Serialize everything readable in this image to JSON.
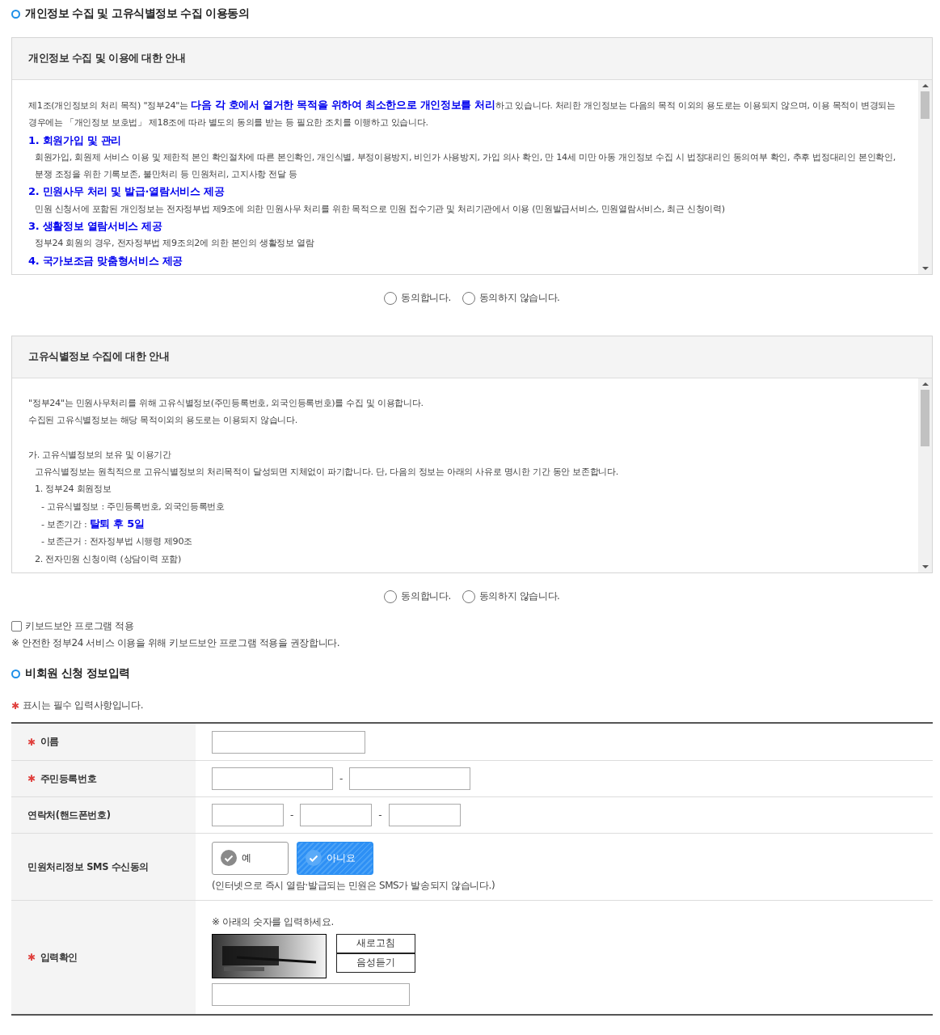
{
  "agreement_title": "개인정보 수집 및 고유식별정보 수집 이용동의",
  "notices": [
    {
      "title": "개인정보 수집 및 이용에 대한 안내",
      "lines": [
        {
          "kind": "text",
          "text": "제1조(개인정보의 처리 목적) \"정부24\"는 **다음 각 호에서 열거한 목적을 위하여 최소한으로 개인정보를 처리**하고 있습니다. 처리한 개인정보는 다음의 목적 이외의 용도로는 이용되지 않으며, 이용 목적이 변경되는 경우에는 「개인정보 보호법」 제18조에 따라 별도의 동의를 받는 등 필요한 조치를 이행하고 있습니다."
        },
        {
          "kind": "heading",
          "text": "1. 회원가입 및 관리"
        },
        {
          "kind": "indent",
          "text": "회원가입, 회원제 서비스 이용 및 제한적 본인 확인절차에 따른 본인확인, 개인식별, 부정이용방지, 비인가 사용방지, 가입 의사 확인, 만 14세 미만 아동 개인정보 수집 시 법정대리인 동의여부 확인, 추후 법정대리인 본인확인, 분쟁 조정을 위한 기록보존, 불만처리 등 민원처리, 고지사항 전달 등"
        },
        {
          "kind": "heading",
          "text": "2. 민원사무 처리 및 발급·열람서비스 제공"
        },
        {
          "kind": "indent",
          "text": "민원 신청서에 포함된 개인정보는 전자정부법 제9조에 의한 민원사무 처리를 위한 목적으로 민원 접수기관 및 처리기관에서 이용 (민원발급서비스, 민원열람서비스, 최근 신청이력)"
        },
        {
          "kind": "heading",
          "text": "3. 생활정보 열람서비스 제공"
        },
        {
          "kind": "indent",
          "text": "정부24 회원의 경우, 전자정부법 제9조의2에 의한 본인의 생활정보 열람"
        },
        {
          "kind": "heading",
          "text": "4. 국가보조금 맞춤형서비스 제공"
        }
      ],
      "options": [
        {
          "label": "동의합니다.",
          "selected": false
        },
        {
          "label": "동의하지 않습니다.",
          "selected": false
        }
      ]
    },
    {
      "title": "고유식별정보 수집에 대한 안내",
      "lines": [
        {
          "kind": "text",
          "text": "\"정부24\"는 민원사무처리를 위해 고유식별정보(주민등록번호, 외국인등록번호)를 수집 및 이용합니다."
        },
        {
          "kind": "text",
          "text": "수집된 고유식별정보는 해당 목적이외의 용도로는 이용되지 않습니다."
        },
        {
          "kind": "blank"
        },
        {
          "kind": "text",
          "text": "가. 고유식별정보의 보유 및 이용기간"
        },
        {
          "kind": "indent",
          "text": "고유식별정보는 원칙적으로 고유식별정보의 처리목적이 달성되면 지체없이 파기합니다. 단, 다음의 정보는 아래의 사유로 명시한 기간 동안 보존합니다."
        },
        {
          "kind": "indent",
          "text": "1. 정부24 회원정보"
        },
        {
          "kind": "sub",
          "text": "- 고유식별정보 : 주민등록번호, 외국인등록번호"
        },
        {
          "kind": "sub",
          "text": "- 보존기간 : **탈퇴 후 5일**"
        },
        {
          "kind": "sub",
          "text": "- 보존근거 : 전자정부법 시행령 제90조"
        },
        {
          "kind": "indent",
          "text": "2. 전자민원 신청이력 (상담이력 포함)"
        }
      ],
      "options": [
        {
          "label": "동의합니다.",
          "selected": false
        },
        {
          "label": "동의하지 않습니다.",
          "selected": false
        }
      ]
    }
  ],
  "keyboard_security": {
    "label": "키보드보안 프로그램 적용",
    "checked": false,
    "note": "※ 안전한 정부24 서비스 이용을 위해 키보드보안 프로그램 적용을 권장합니다."
  },
  "form_title": "비회원 신청 정보입력",
  "required_mark": "✱",
  "required_note": "표시는 필수 입력사항입니다.",
  "rows": [
    {
      "kind": "name",
      "label": "이름",
      "required": true
    },
    {
      "kind": "resident",
      "label": "주민등록번호",
      "required": true,
      "separator": "-"
    },
    {
      "kind": "phone",
      "label": "연락처(핸드폰번호)",
      "required": false,
      "separators": [
        "-",
        "-"
      ]
    },
    {
      "kind": "sms",
      "label": "민원처리정보 SMS 수신동의",
      "required": false,
      "choices": [
        {
          "label": "예",
          "selected": false
        },
        {
          "label": "아니요",
          "selected": true
        }
      ],
      "note": "(인터넷으로 즉시 열람·발급되는 민원은 SMS가 발송되지 않습니다.)"
    },
    {
      "kind": "captcha",
      "label": "입력확인",
      "required": true,
      "instruction": "※ 아래의 숫자를 입력하세요.",
      "buttons": [
        "새로고침",
        "음성듣기"
      ]
    }
  ]
}
